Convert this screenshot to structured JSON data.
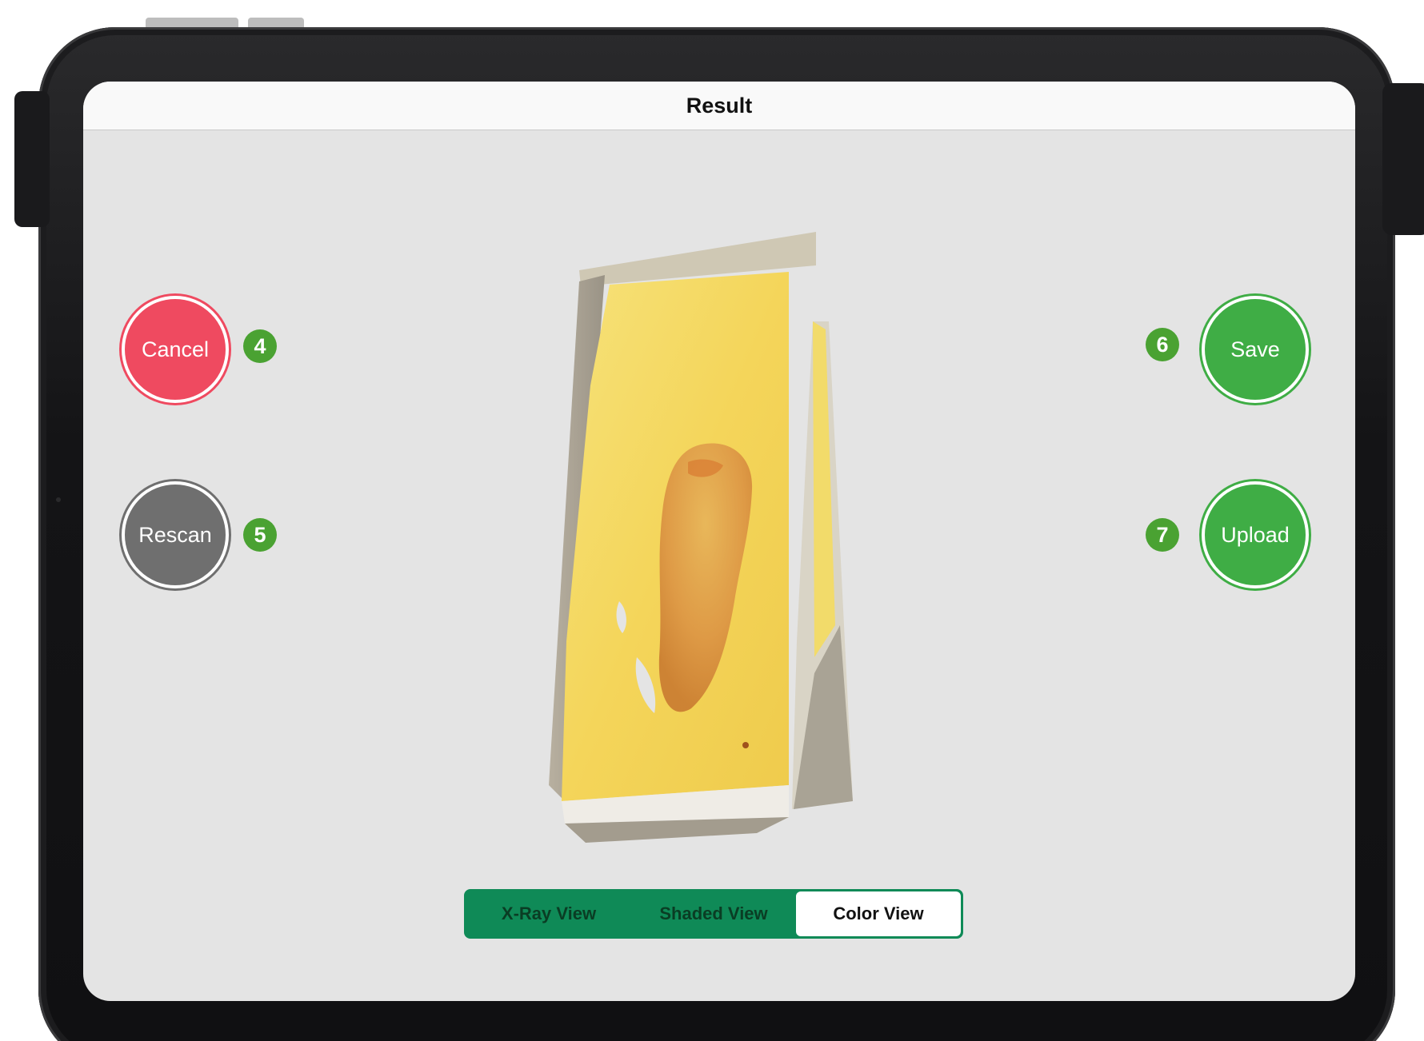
{
  "navbar": {
    "title": "Result"
  },
  "actions": {
    "cancel": "Cancel",
    "rescan": "Rescan",
    "save": "Save",
    "upload": "Upload"
  },
  "callouts": {
    "cancel": "4",
    "rescan": "5",
    "save": "6",
    "upload": "7"
  },
  "view_mode": {
    "options": [
      "X-Ray View",
      "Shaded View",
      "Color View"
    ],
    "selected": "Color View"
  },
  "colors": {
    "cancel": "#ef4a60",
    "rescan": "#6f6f6f",
    "save": "#3fad45",
    "upload": "#3fad45",
    "segmented_accent": "#0f8a57",
    "callout": "#4aa232"
  }
}
